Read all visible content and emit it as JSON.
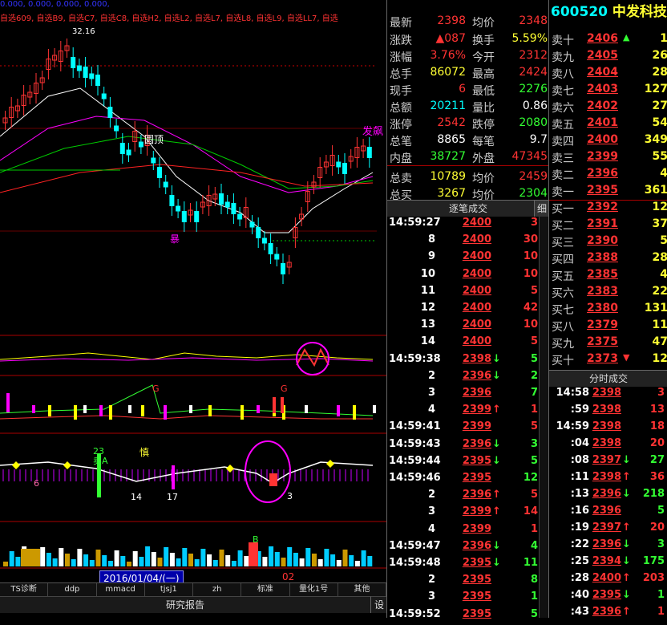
{
  "chart": {
    "top_values": "0.000, 0.000, 0.000, 0.000,",
    "top_watchlist": "自选609, 自选B9, 自选C7, 自选C8, 自选H2, 自选L2, 自选L7, 自选L8, 自选L9, 自选LL7, 自选",
    "price_label": "32.16",
    "label_yuanding": "圆顶",
    "label_fabiao": "发飙",
    "label_bao": "暴",
    "label_shen": "慎",
    "label_23": "23",
    "label_mai": "卖A",
    "label_G1": "G",
    "label_G2": "G",
    "label_B": "B",
    "label_14": "14",
    "label_17": "17",
    "label_3": "3",
    "label_6": "6",
    "date": "2016/01/04/(一)",
    "date_next": "02",
    "colors": {
      "up": "#ff3333",
      "down": "#00ffff",
      "ma_white": "#ffffff",
      "ma_magenta": "#ff00ff",
      "ma_green": "#00cc00",
      "ma_red": "#ff2222"
    }
  },
  "bottom_tabs": [
    "TS诊断",
    "ddp",
    "mmacd",
    "tjsj1",
    "zh",
    "标准",
    "量化1号",
    "其他"
  ],
  "research_report": "研究报告",
  "settings_label": "设",
  "quote": {
    "rows": [
      {
        "l1": "最新",
        "v1": "2398",
        "c1": "red",
        "l2": "均价",
        "v2": "2348",
        "c2": "red"
      },
      {
        "l1": "涨跌",
        "v1": "▲087",
        "c1": "red",
        "l2": "换手",
        "v2": "5.59%",
        "c2": "yellow"
      },
      {
        "l1": "涨幅",
        "v1": "3.76%",
        "c1": "red",
        "l2": "今开",
        "v2": "2312",
        "c2": "red"
      },
      {
        "l1": "总手",
        "v1": "86072",
        "c1": "yellow",
        "l2": "最高",
        "v2": "2424",
        "c2": "red"
      },
      {
        "l1": "现手",
        "v1": "6",
        "c1": "red",
        "l2": "最低",
        "v2": "2276",
        "c2": "green"
      },
      {
        "l1": "总额",
        "v1": "20211",
        "c1": "cyan",
        "l2": "量比",
        "v2": "0.86",
        "c2": "white"
      },
      {
        "l1": "涨停",
        "v1": "2542",
        "c1": "red",
        "l2": "跌停",
        "v2": "2080",
        "c2": "green"
      },
      {
        "l1": "总笔",
        "v1": "8865",
        "c1": "white",
        "l2": "每笔",
        "v2": "9.7",
        "c2": "white"
      },
      {
        "l1": "内盘",
        "v1": "38727",
        "c1": "green",
        "l2": "外盘",
        "v2": "47345",
        "c2": "red"
      },
      {
        "l1": "总卖",
        "v1": "10789",
        "c1": "yellow",
        "l2": "均价",
        "v2": "2459",
        "c2": "red"
      },
      {
        "l1": "总买",
        "v1": "3267",
        "c1": "yellow",
        "l2": "均价",
        "v2": "2304",
        "c2": "green"
      }
    ],
    "tick_header": "逐笔成交",
    "tick_side": "细",
    "ticks": [
      {
        "t": "14:59:27",
        "p": "2400",
        "a": "",
        "v": "3",
        "pc": "red",
        "vc": "red"
      },
      {
        "t": "8",
        "p": "2400",
        "a": "",
        "v": "30",
        "pc": "red",
        "vc": "red"
      },
      {
        "t": "9",
        "p": "2400",
        "a": "",
        "v": "10",
        "pc": "red",
        "vc": "red"
      },
      {
        "t": "10",
        "p": "2400",
        "a": "",
        "v": "10",
        "pc": "red",
        "vc": "red"
      },
      {
        "t": "11",
        "p": "2400",
        "a": "",
        "v": "5",
        "pc": "red",
        "vc": "red"
      },
      {
        "t": "12",
        "p": "2400",
        "a": "",
        "v": "42",
        "pc": "red",
        "vc": "red"
      },
      {
        "t": "13",
        "p": "2400",
        "a": "",
        "v": "10",
        "pc": "red",
        "vc": "red"
      },
      {
        "t": "14",
        "p": "2400",
        "a": "",
        "v": "5",
        "pc": "red",
        "vc": "red"
      },
      {
        "t": "14:59:38",
        "p": "2398",
        "a": "↓",
        "v": "5",
        "pc": "red",
        "vc": "green"
      },
      {
        "t": "2",
        "p": "2396",
        "a": "↓",
        "v": "2",
        "pc": "red",
        "vc": "green"
      },
      {
        "t": "3",
        "p": "2396",
        "a": "",
        "v": "7",
        "pc": "red",
        "vc": "green"
      },
      {
        "t": "4",
        "p": "2399",
        "a": "↑",
        "v": "1",
        "pc": "red",
        "vc": "red"
      },
      {
        "t": "14:59:41",
        "p": "2399",
        "a": "",
        "v": "5",
        "pc": "red",
        "vc": "red"
      },
      {
        "t": "14:59:43",
        "p": "2396",
        "a": "↓",
        "v": "3",
        "pc": "red",
        "vc": "green"
      },
      {
        "t": "14:59:44",
        "p": "2395",
        "a": "↓",
        "v": "5",
        "pc": "red",
        "vc": "green"
      },
      {
        "t": "14:59:46",
        "p": "2395",
        "a": "",
        "v": "12",
        "pc": "red",
        "vc": "green"
      },
      {
        "t": "2",
        "p": "2396",
        "a": "↑",
        "v": "5",
        "pc": "red",
        "vc": "red"
      },
      {
        "t": "3",
        "p": "2399",
        "a": "↑",
        "v": "14",
        "pc": "red",
        "vc": "red"
      },
      {
        "t": "4",
        "p": "2399",
        "a": "",
        "v": "1",
        "pc": "red",
        "vc": "red"
      },
      {
        "t": "14:59:47",
        "p": "2396",
        "a": "↓",
        "v": "4",
        "pc": "red",
        "vc": "green"
      },
      {
        "t": "14:59:48",
        "p": "2395",
        "a": "↓",
        "v": "11",
        "pc": "red",
        "vc": "green"
      },
      {
        "t": "2",
        "p": "2395",
        "a": "",
        "v": "8",
        "pc": "red",
        "vc": "green"
      },
      {
        "t": "3",
        "p": "2395",
        "a": "",
        "v": "1",
        "pc": "red",
        "vc": "green"
      },
      {
        "t": "14:59:52",
        "p": "2395",
        "a": "",
        "v": "5",
        "pc": "red",
        "vc": "green"
      }
    ]
  },
  "book": {
    "code": "600520",
    "name": "中发科技",
    "asks": [
      {
        "l": "卖十",
        "p": "2406",
        "m": "▲",
        "mc": "green",
        "v": "1"
      },
      {
        "l": "卖九",
        "p": "2405",
        "m": "",
        "mc": "",
        "v": "26"
      },
      {
        "l": "卖八",
        "p": "2404",
        "m": "",
        "mc": "",
        "v": "28"
      },
      {
        "l": "卖七",
        "p": "2403",
        "m": "",
        "mc": "",
        "v": "127"
      },
      {
        "l": "卖六",
        "p": "2402",
        "m": "",
        "mc": "",
        "v": "27"
      },
      {
        "l": "卖五",
        "p": "2401",
        "m": "",
        "mc": "",
        "v": "54"
      },
      {
        "l": "卖四",
        "p": "2400",
        "m": "",
        "mc": "",
        "v": "349"
      },
      {
        "l": "卖三",
        "p": "2399",
        "m": "",
        "mc": "",
        "v": "55"
      },
      {
        "l": "卖二",
        "p": "2396",
        "m": "",
        "mc": "",
        "v": "4"
      },
      {
        "l": "卖一",
        "p": "2395",
        "m": "",
        "mc": "",
        "v": "361"
      }
    ],
    "bids": [
      {
        "l": "买一",
        "p": "2392",
        "m": "",
        "mc": "",
        "v": "12"
      },
      {
        "l": "买二",
        "p": "2391",
        "m": "",
        "mc": "",
        "v": "37"
      },
      {
        "l": "买三",
        "p": "2390",
        "m": "",
        "mc": "",
        "v": "5"
      },
      {
        "l": "买四",
        "p": "2388",
        "m": "",
        "mc": "",
        "v": "28"
      },
      {
        "l": "买五",
        "p": "2385",
        "m": "",
        "mc": "",
        "v": "4"
      },
      {
        "l": "买六",
        "p": "2383",
        "m": "",
        "mc": "",
        "v": "22"
      },
      {
        "l": "买七",
        "p": "2380",
        "m": "",
        "mc": "",
        "v": "131"
      },
      {
        "l": "买八",
        "p": "2379",
        "m": "",
        "mc": "",
        "v": "11"
      },
      {
        "l": "买九",
        "p": "2375",
        "m": "",
        "mc": "",
        "v": "47"
      },
      {
        "l": "买十",
        "p": "2373",
        "m": "▼",
        "mc": "red",
        "v": "12"
      }
    ],
    "fs_header": "分时成交",
    "fs": [
      {
        "t": "14:58",
        "p": "2398",
        "a": "",
        "v": "3",
        "pc": "red",
        "vc": "red"
      },
      {
        "t": ":59",
        "p": "2398",
        "a": "",
        "v": "13",
        "pc": "red",
        "vc": "red"
      },
      {
        "t": "14:59",
        "p": "2398",
        "a": "",
        "v": "18",
        "pc": "red",
        "vc": "red"
      },
      {
        "t": ":04",
        "p": "2398",
        "a": "",
        "v": "20",
        "pc": "red",
        "vc": "red"
      },
      {
        "t": ":08",
        "p": "2397",
        "a": "↓",
        "v": "27",
        "pc": "red",
        "vc": "green"
      },
      {
        "t": ":11",
        "p": "2398",
        "a": "↑",
        "v": "36",
        "pc": "red",
        "vc": "red"
      },
      {
        "t": ":13",
        "p": "2396",
        "a": "↓",
        "v": "218",
        "pc": "red",
        "vc": "green"
      },
      {
        "t": ":16",
        "p": "2396",
        "a": "",
        "v": "5",
        "pc": "red",
        "vc": "green"
      },
      {
        "t": ":19",
        "p": "2397",
        "a": "↑",
        "v": "20",
        "pc": "red",
        "vc": "red"
      },
      {
        "t": ":22",
        "p": "2396",
        "a": "↓",
        "v": "3",
        "pc": "red",
        "vc": "green"
      },
      {
        "t": ":25",
        "p": "2394",
        "a": "↓",
        "v": "175",
        "pc": "red",
        "vc": "green"
      },
      {
        "t": ":28",
        "p": "2400",
        "a": "↑",
        "v": "203",
        "pc": "red",
        "vc": "red"
      },
      {
        "t": ":40",
        "p": "2395",
        "a": "↓",
        "v": "1",
        "pc": "red",
        "vc": "green"
      },
      {
        "t": ":43",
        "p": "2396",
        "a": "↑",
        "v": "1",
        "pc": "red",
        "vc": "red"
      }
    ]
  }
}
